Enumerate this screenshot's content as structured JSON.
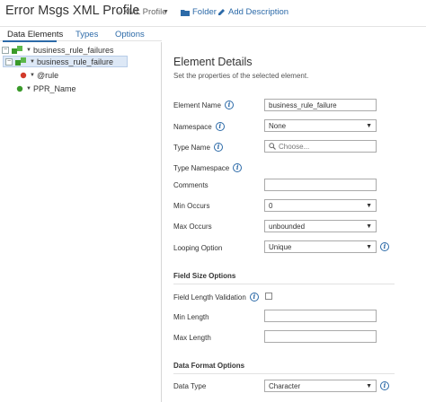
{
  "header": {
    "title": "Error Msgs XML Profile",
    "profile_type": "- XML Profile",
    "folder_label": "Folder",
    "add_description_label": "Add Description"
  },
  "tabs": [
    {
      "label": "Data Elements",
      "active": true
    },
    {
      "label": "Types",
      "active": false
    },
    {
      "label": "Options",
      "active": false
    }
  ],
  "tree": {
    "nodes": [
      {
        "label": "business_rule_failures",
        "expander": "⊟",
        "selected": false
      },
      {
        "label": "business_rule_failure",
        "expander": "⊟",
        "selected": true
      },
      {
        "label": "@rule",
        "expander": "",
        "selected": false
      },
      {
        "label": "PPR_Name",
        "expander": "",
        "selected": false
      }
    ]
  },
  "details": {
    "title": "Element Details",
    "subtitle": "Set the properties of the selected element.",
    "element_name": {
      "label": "Element Name",
      "value": "business_rule_failure"
    },
    "namespace": {
      "label": "Namespace",
      "value": "None"
    },
    "type_name": {
      "label": "Type Name",
      "placeholder": "Choose..."
    },
    "type_namespace": {
      "label": "Type Namespace"
    },
    "comments": {
      "label": "Comments",
      "value": ""
    },
    "min_occurs": {
      "label": "Min Occurs",
      "value": "0"
    },
    "max_occurs": {
      "label": "Max Occurs",
      "value": "unbounded"
    },
    "looping_option": {
      "label": "Looping Option",
      "value": "Unique"
    },
    "field_size_section": "Field Size Options",
    "field_length_validation": {
      "label": "Field Length Validation",
      "checked": false
    },
    "min_length": {
      "label": "Min Length",
      "value": ""
    },
    "max_length": {
      "label": "Max Length",
      "value": ""
    },
    "data_format_section": "Data Format Options",
    "data_type": {
      "label": "Data Type",
      "value": "Character"
    }
  },
  "colors": {
    "link": "#2c6aa8",
    "selection": "#dde8f6",
    "element_icon": "#3a9a2a",
    "attribute_icon": "#d23a2a"
  },
  "icons": [
    "folder-icon",
    "pencil-icon",
    "element-icon",
    "attribute-icon",
    "info-icon",
    "search-icon",
    "dropdown-arrow-icon"
  ]
}
